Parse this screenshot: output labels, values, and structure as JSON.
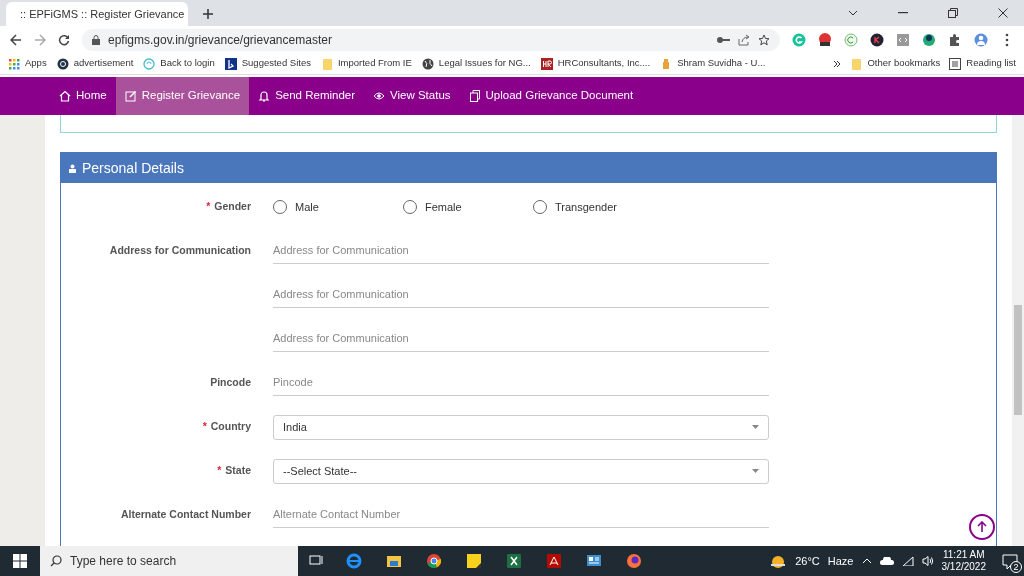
{
  "browser": {
    "tab_title": ":: EPFiGMS :: Register Grievance",
    "url": "epfigms.gov.in/grievance/grievancemaster",
    "bookmarks": [
      {
        "label": "Apps",
        "kind": "apps"
      },
      {
        "label": "advertisement",
        "kind": "circle"
      },
      {
        "label": "Back to login",
        "kind": "swirl"
      },
      {
        "label": "Suggested Sites",
        "kind": "bing"
      },
      {
        "label": "Imported From IE",
        "kind": "folder"
      },
      {
        "label": "Legal Issues for NG...",
        "kind": "globe"
      },
      {
        "label": "HRConsultants, Inc....",
        "kind": "hr"
      },
      {
        "label": "Shram Suvidha - U...",
        "kind": "figure"
      }
    ],
    "other_bookmarks": "Other bookmarks",
    "reading_list": "Reading list"
  },
  "nav": [
    {
      "label": "Home",
      "selected": false
    },
    {
      "label": "Register Grievance",
      "selected": true
    },
    {
      "label": "Send Reminder",
      "selected": false
    },
    {
      "label": "View Status",
      "selected": false
    },
    {
      "label": "Upload Grievance Document",
      "selected": false
    }
  ],
  "panel": {
    "title": "Personal Details",
    "fields": [
      {
        "kind": "radio",
        "label": "Gender",
        "required_mark": "*",
        "options": [
          {
            "label": "Male",
            "selected": false
          },
          {
            "label": "Female",
            "selected": false
          },
          {
            "label": "Transgender",
            "selected": false
          }
        ]
      },
      {
        "kind": "text",
        "label": "Address for Communication",
        "placeholder": "Address for Communication"
      },
      {
        "kind": "text",
        "placeholder": "Address for Communication"
      },
      {
        "kind": "text",
        "placeholder": "Address for Communication"
      },
      {
        "kind": "text",
        "label": "Pincode",
        "placeholder": "Pincode"
      },
      {
        "kind": "select",
        "label": "Country",
        "required_mark": "*",
        "value": "India"
      },
      {
        "kind": "select",
        "label": "State",
        "required_mark": "*",
        "value": "--Select State--"
      },
      {
        "kind": "text",
        "label": "Alternate Contact Number",
        "placeholder": "Alternate Contact Number"
      }
    ]
  },
  "taskbar": {
    "search_placeholder": "Type here to search",
    "temperature": "26°C",
    "weather": "Haze",
    "time": "11:21 AM",
    "date": "3/12/2022",
    "notifications": "2"
  }
}
